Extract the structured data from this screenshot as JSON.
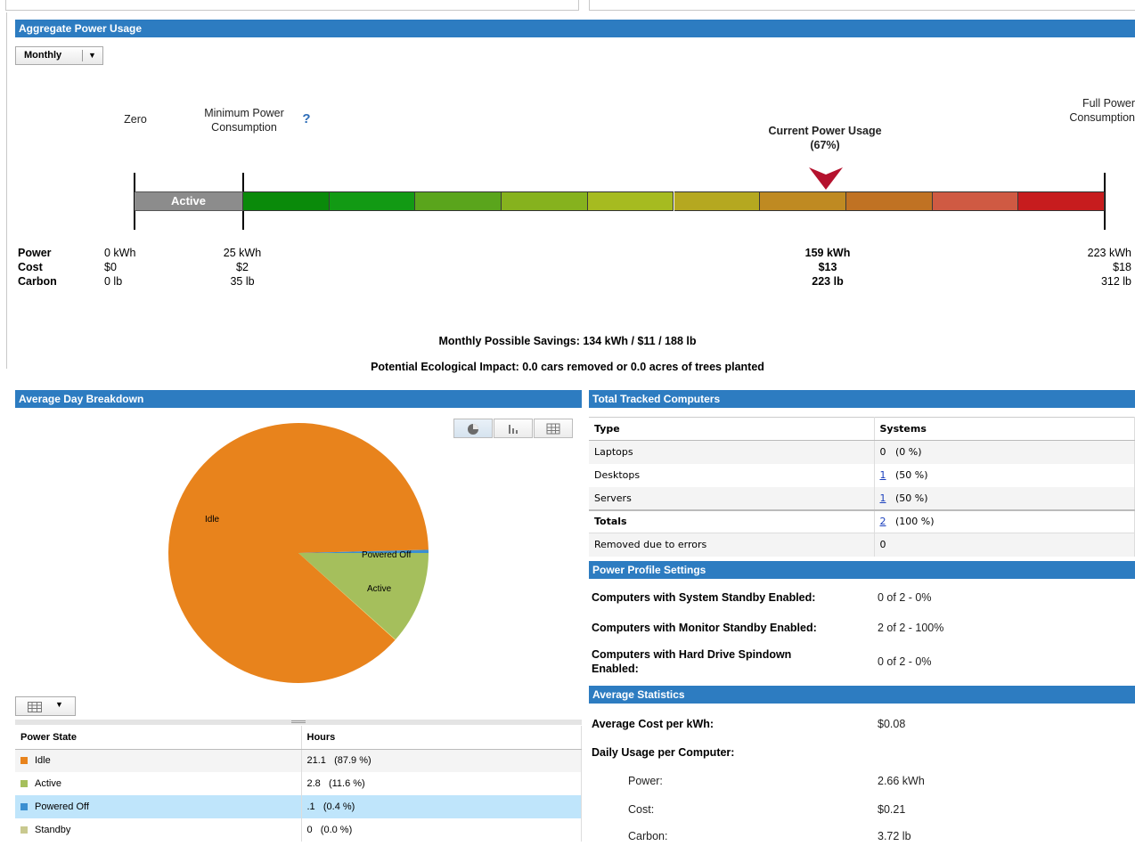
{
  "aggregate": {
    "header": "Aggregate Power Usage",
    "period_select": "Monthly",
    "labels": {
      "zero": "Zero",
      "min_line1": "Minimum Power",
      "min_line2": "Consumption",
      "full_line1": "Full Power",
      "full_line2": "Consumption",
      "current_line1": "Current Power Usage",
      "current_line2": "(67%)",
      "active_segment": "Active"
    },
    "current_pct": 67,
    "row_labels": {
      "power": "Power",
      "cost": "Cost",
      "carbon": "Carbon"
    },
    "zero_vals": {
      "power": "0 kWh",
      "cost": "$0",
      "carbon": "0 lb"
    },
    "min_vals": {
      "power": "25 kWh",
      "cost": "$2",
      "carbon": "35 lb"
    },
    "current_vals": {
      "power": "159 kWh",
      "cost": "$13",
      "carbon": "223 lb"
    },
    "full_vals": {
      "power": "223 kWh",
      "cost": "$18",
      "carbon": "312 lb"
    },
    "gradient_colors": [
      "#0a8a0a",
      "#129a14",
      "#5aa51c",
      "#86b21e",
      "#a6bb20",
      "#b5a820",
      "#bf8a22",
      "#c07223",
      "#cf5a43",
      "#c71c1e"
    ],
    "savings": "Monthly Possible Savings: 134 kWh / $11 / 188 lb",
    "eco": "Potential Ecological Impact: 0.0 cars removed or 0.0 acres of trees planted"
  },
  "breakdown": {
    "header": "Average Day Breakdown",
    "pie_labels": {
      "idle": "Idle",
      "powered_off": "Powered Off",
      "active": "Active"
    },
    "table_headers": {
      "state": "Power State",
      "hours": "Hours"
    },
    "rows": [
      {
        "state": "Idle",
        "hours": "21.1",
        "pct": "(87.9 %)",
        "color": "#e8831c"
      },
      {
        "state": "Active",
        "hours": "2.8",
        "pct": "(11.6 %)",
        "color": "#a5bf5c"
      },
      {
        "state": "Powered Off",
        "hours": ".1",
        "pct": "(0.4 %)",
        "color": "#3a8fd1"
      },
      {
        "state": "Standby",
        "hours": "0",
        "pct": "(0.0 %)",
        "color": "#c9c98f"
      }
    ],
    "selected_row": 2,
    "colors": {
      "idle": "#e8831c",
      "active": "#a5bf5c",
      "powered_off": "#3a8fd1",
      "standby": "#f2e77a"
    }
  },
  "tracked": {
    "header": "Total Tracked Computers",
    "col_type": "Type",
    "col_systems": "Systems",
    "rows": [
      {
        "type": "Laptops",
        "count": "0",
        "pct": "(0 %)",
        "link": false
      },
      {
        "type": "Desktops",
        "count": "1",
        "pct": "(50 %)",
        "link": true
      },
      {
        "type": "Servers",
        "count": "1",
        "pct": "(50 %)",
        "link": true
      }
    ],
    "totals_label": "Totals",
    "totals_count": "2",
    "totals_pct": "(100 %)",
    "removed_label": "Removed due to errors",
    "removed_value": "0"
  },
  "profile": {
    "header": "Power Profile Settings",
    "system_label": "Computers with System Standby Enabled:",
    "system_value": "0 of 2 - 0%",
    "monitor_label": "Computers with Monitor Standby Enabled:",
    "monitor_value": "2 of 2 - 100%",
    "hdd_label_line1": "Computers with Hard Drive Spindown",
    "hdd_label_line2": "Enabled:",
    "hdd_value": "0 of 2 - 0%"
  },
  "stats": {
    "header": "Average Statistics",
    "cost_label": "Average Cost per kWh:",
    "cost_value": "$0.08",
    "daily_label": "Daily Usage per Computer:",
    "power_label": "Power:",
    "power_value": "2.66 kWh",
    "cost2_label": "Cost:",
    "cost2_value": "$0.21",
    "carbon_label": "Carbon:",
    "carbon_value": "3.72 lb"
  }
}
